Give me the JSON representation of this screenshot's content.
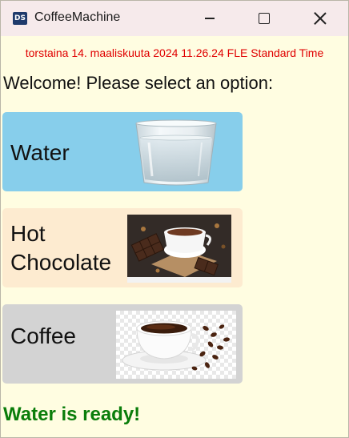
{
  "window": {
    "title": "CoffeeMachine",
    "icon_text": "DS",
    "icon_name": "app-icon"
  },
  "datetime": "torstaina 14. maaliskuuta 2024 11.26.24 FLE Standard Time",
  "welcome": "Welcome! Please select an option:",
  "options": [
    {
      "label": "Water",
      "image": "glass-of-water-image",
      "color": "#87ceeb"
    },
    {
      "label": "Hot Chocolate",
      "image": "hot-chocolate-image",
      "color": "#fdebd0"
    },
    {
      "label": "Coffee",
      "image": "coffee-cup-image",
      "color": "#d3d3d3"
    }
  ],
  "status": "Water is ready!",
  "colors": {
    "datetime": "#e00000",
    "status": "#0a7d0a",
    "background": "#fffde1"
  }
}
